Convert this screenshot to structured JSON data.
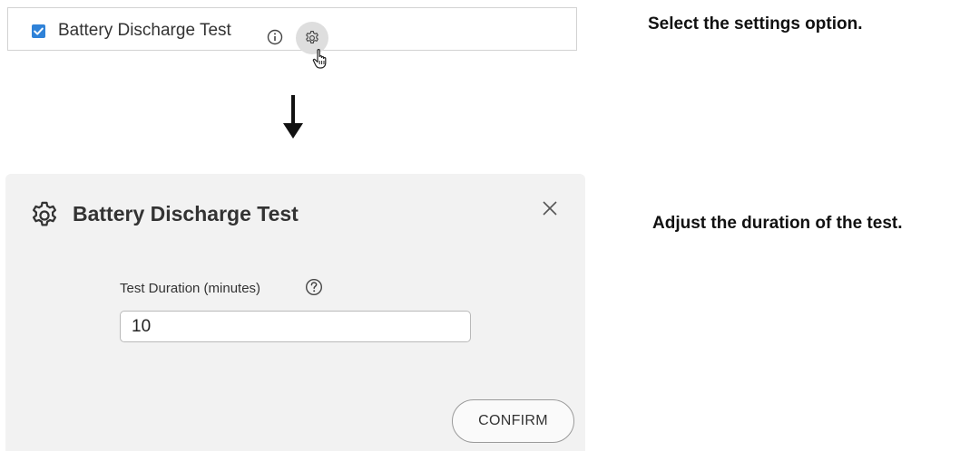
{
  "step1": {
    "checkbox_checked": true,
    "test_label": "Battery Discharge Test",
    "instruction": "Select the settings option."
  },
  "step2": {
    "dialog_title": "Battery Discharge Test",
    "field_label": "Test Duration (minutes)",
    "field_value": "10",
    "confirm_label": "CONFIRM",
    "instruction": "Adjust the duration of the test."
  },
  "colors": {
    "checkbox_blue": "#2f82d8",
    "panel_bg": "#f2f2f2",
    "gear_button_bg": "#dedede"
  },
  "icons": [
    "check-icon",
    "info-icon",
    "gear-icon",
    "hand-cursor-icon",
    "down-arrow-icon",
    "close-icon",
    "help-icon"
  ]
}
